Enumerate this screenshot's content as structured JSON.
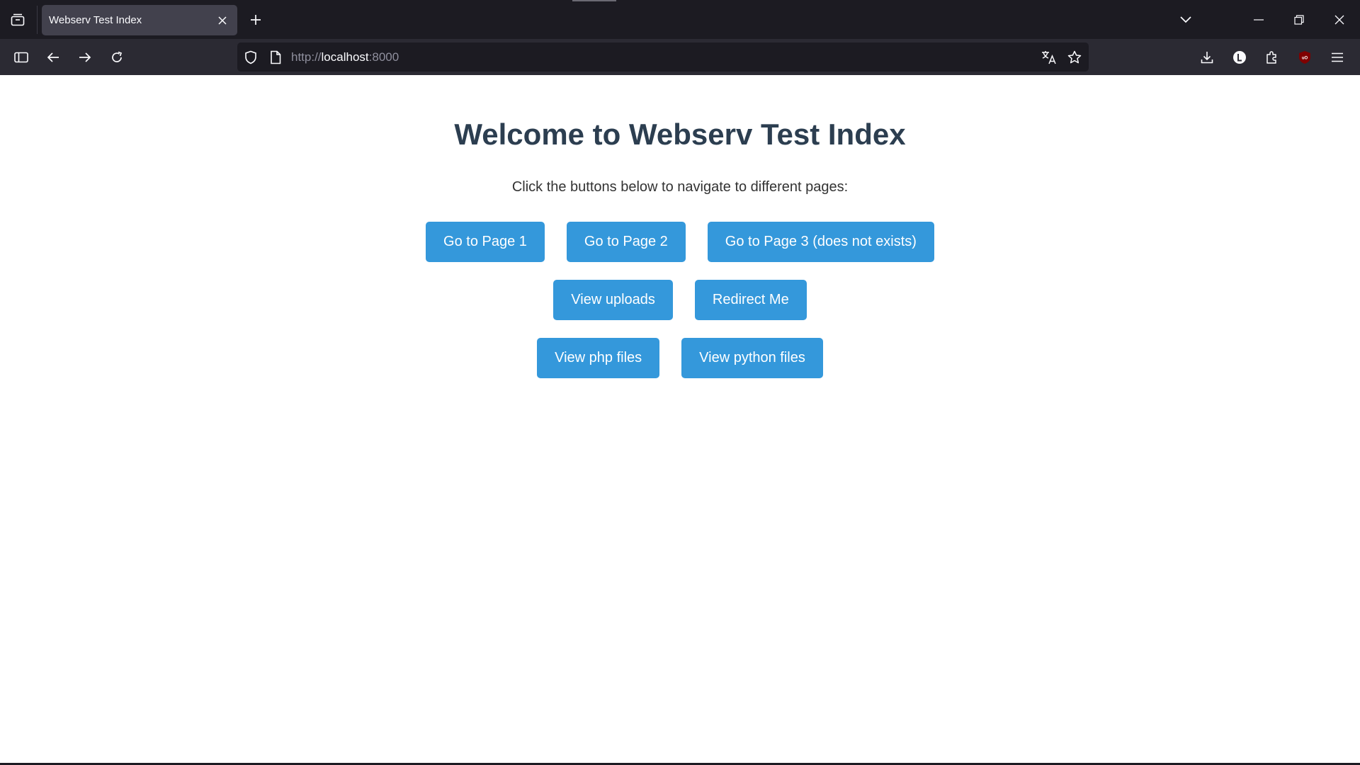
{
  "browser": {
    "tab_title": "Webserv Test Index",
    "url": {
      "scheme": "http://",
      "host": "localhost",
      "port": ":8000"
    },
    "icons": {
      "tab_list": "tab-list-icon",
      "tab_close": "close-icon",
      "new_tab": "plus-icon",
      "tab_overflow": "chevron-down-icon",
      "minimize": "minimize-icon",
      "restore": "restore-icon",
      "close_window": "close-icon",
      "sidebar": "sidebar-icon",
      "back": "back-arrow-icon",
      "forward": "forward-arrow-icon",
      "reload": "reload-icon",
      "tracking_protection": "shield-icon",
      "page_info": "page-icon",
      "translate": "translate-icon",
      "bookmark": "star-icon",
      "downloads": "download-icon",
      "account": "account-icon",
      "extensions": "puzzle-icon",
      "ublock": "ublock-icon",
      "menu": "hamburger-menu-icon"
    },
    "colors": {
      "tabbar_bg": "#1c1b22",
      "navbar_bg": "#2b2a33",
      "active_tab_bg": "#42414d",
      "ublock_red": "#800000"
    }
  },
  "page": {
    "title": "Welcome to Webserv Test Index",
    "subtitle": "Click the buttons below to navigate to different pages:",
    "button_rows": [
      [
        {
          "label": "Go to Page 1"
        },
        {
          "label": "Go to Page 2"
        },
        {
          "label": "Go to Page 3 (does not exists)"
        }
      ],
      [
        {
          "label": "View uploads"
        },
        {
          "label": "Redirect Me"
        }
      ],
      [
        {
          "label": "View php files"
        },
        {
          "label": "View python files"
        }
      ]
    ],
    "colors": {
      "title": "#2c3e50",
      "button_bg": "#3498db",
      "button_text": "#ffffff"
    }
  }
}
